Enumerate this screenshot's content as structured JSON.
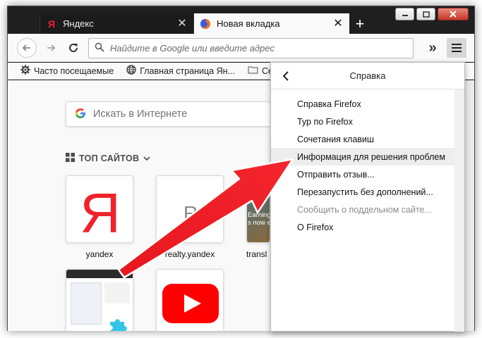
{
  "tabs": [
    {
      "title": "Яндекс",
      "active": false,
      "icon": "yandex-favicon"
    },
    {
      "title": "Новая вкладка",
      "active": true,
      "icon": "firefox-favicon"
    }
  ],
  "toolbar": {
    "url_placeholder": "Найдите в Google или введите адрес"
  },
  "bookmarks": [
    {
      "label": "Часто посещаемые",
      "icon": "gear-icon"
    },
    {
      "label": "Главная страница Ян...",
      "icon": "globe-icon"
    },
    {
      "label": "Серви",
      "icon": "folder-icon"
    }
  ],
  "newtab": {
    "search_placeholder": "Искать в Интернете",
    "topsites_title": "ТОП САЙТОВ",
    "tiles": [
      {
        "label": "yandex",
        "glyph": "Я"
      },
      {
        "label": "realty.yandex",
        "glyph": "R"
      },
      {
        "label": "transl",
        "overlay_text_1": "Earning m",
        "overlay_text_2": "s now eat"
      }
    ]
  },
  "help_menu": {
    "title": "Справка",
    "items": [
      {
        "label": "Справка Firefox",
        "disabled": false
      },
      {
        "label": "Тур по Firefox",
        "disabled": false
      },
      {
        "label": "Сочетания клавиш",
        "disabled": false
      },
      {
        "label": "Информация для решения проблем",
        "disabled": false,
        "highlighted": true
      },
      {
        "label": "Отправить отзыв...",
        "disabled": false
      },
      {
        "label": "Перезапустить без дополнений...",
        "disabled": false
      },
      {
        "label": "Сообщить о поддельном сайте...",
        "disabled": true
      },
      {
        "label": "О Firefox",
        "disabled": false
      }
    ]
  },
  "colors": {
    "arrow": "#e8171f",
    "yandex_red": "#f0222a",
    "youtube_red": "#ff0000",
    "titlebar": "#1f1f1f"
  }
}
